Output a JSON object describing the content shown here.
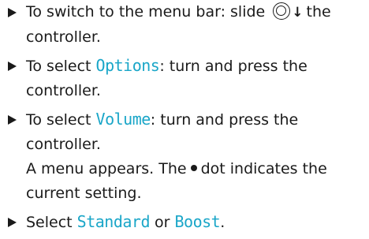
{
  "steps": [
    {
      "pre": "To switch to the menu bar: slide",
      "icon": "controller-icon",
      "arrow": "↓",
      "post": "the controller."
    },
    {
      "pre": "To select ",
      "keyword": "Options",
      "post": ": turn and press the controller."
    },
    {
      "pre": "To select ",
      "keyword": "Volume",
      "post": ": turn and press the controller.",
      "result_pre": "A menu appears. The",
      "result_post": "dot indicates the current setting."
    },
    {
      "pre": "Select ",
      "keyword": "Standard",
      "mid": " or ",
      "keyword2": "Boost",
      "post": "."
    }
  ],
  "colors": {
    "keyword": "#1aa6c8",
    "text": "#1a1a1a"
  }
}
